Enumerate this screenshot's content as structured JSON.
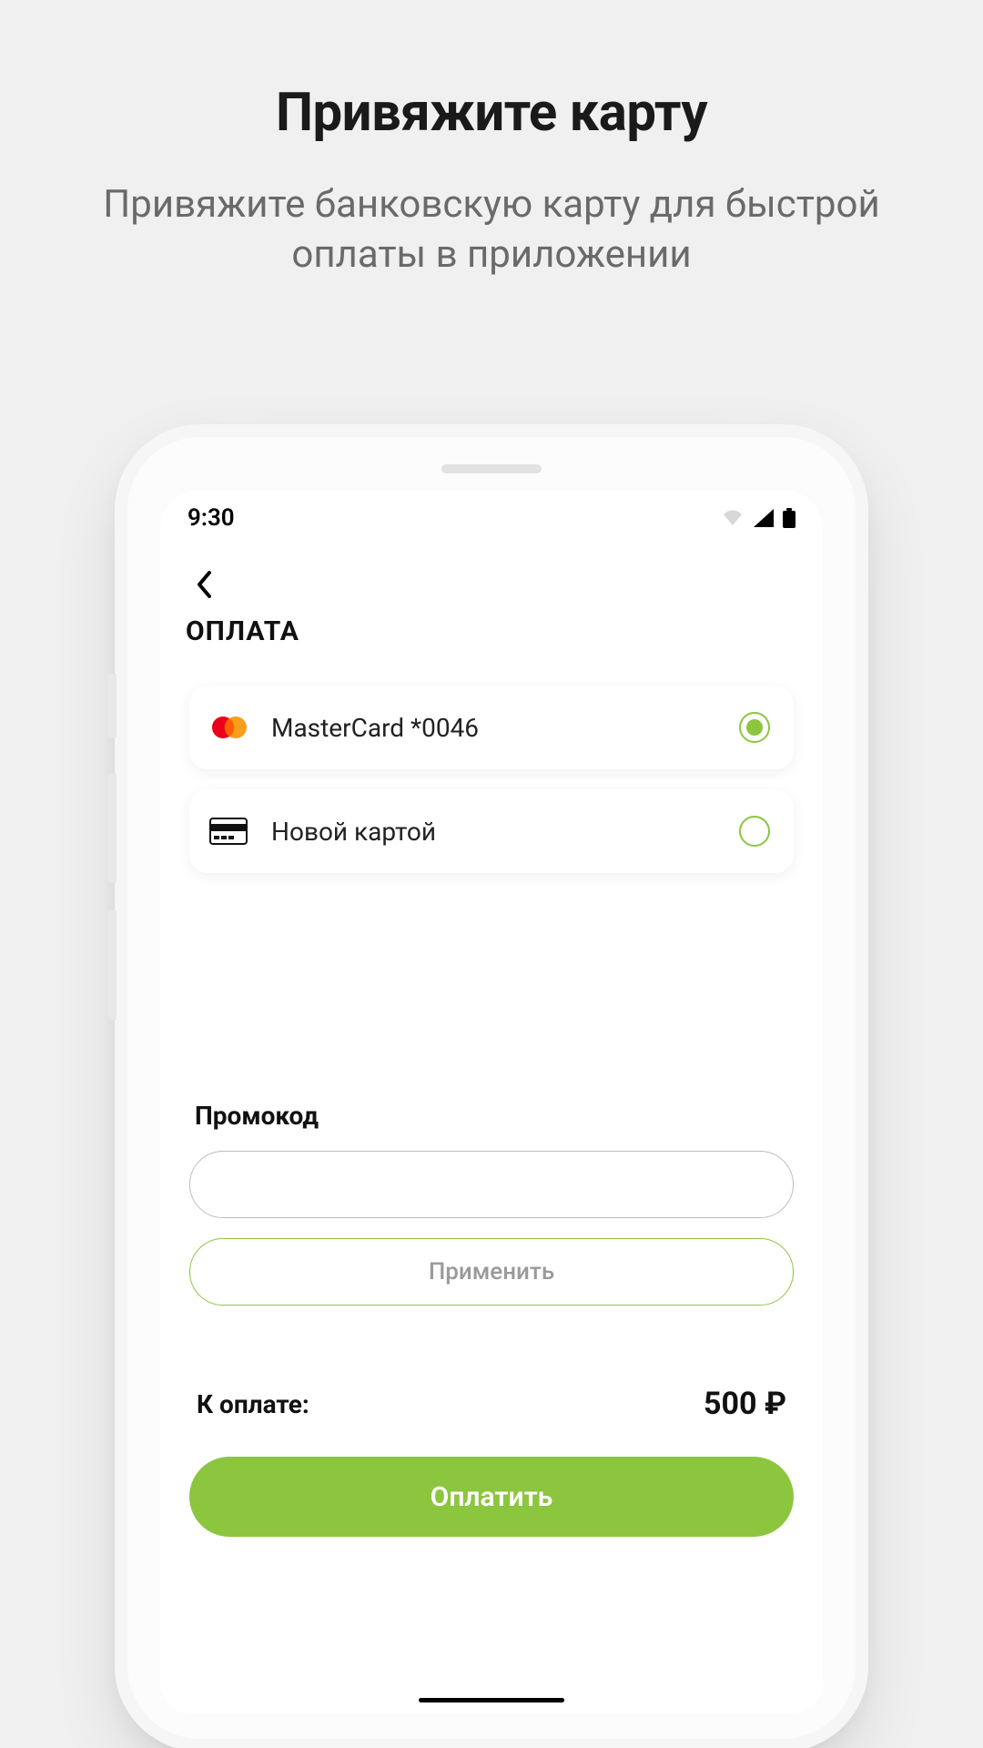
{
  "header": {
    "title": "Привяжите карту",
    "subtitle": "Привяжите банковскую карту для быстрой оплаты в приложении"
  },
  "status": {
    "time": "9:30"
  },
  "screen": {
    "title": "ОПЛАТА",
    "cards": [
      {
        "label": "MasterCard *0046",
        "selected": true,
        "icon": "mastercard"
      },
      {
        "label": "Новой картой",
        "selected": false,
        "icon": "generic-card"
      }
    ],
    "promo": {
      "label": "Промокод",
      "value": "",
      "apply": "Применить"
    },
    "total": {
      "label": "К оплате:",
      "value": "500 ₽"
    },
    "pay": "Оплатить"
  },
  "colors": {
    "accent": "#8cc63f"
  }
}
